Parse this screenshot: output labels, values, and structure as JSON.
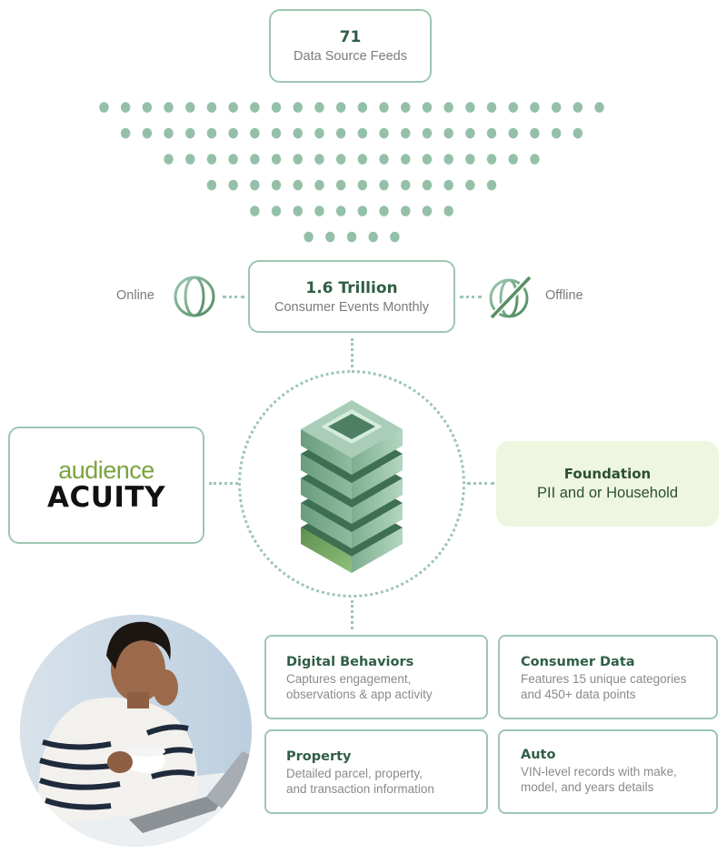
{
  "data_sources": {
    "count": "71",
    "label": "Data Source Feeds"
  },
  "funnel_dots": {
    "rows": [
      24,
      22,
      18,
      14,
      10,
      5
    ],
    "color": "#94c0a8"
  },
  "events": {
    "count": "1.6 Trillion",
    "label": "Consumer Events Monthly"
  },
  "channels": {
    "online": {
      "label": "Online",
      "icon": "globe-icon"
    },
    "offline": {
      "label": "Offline",
      "icon": "globe-crossed-icon"
    }
  },
  "hub": {
    "icon": "server-stack-icon"
  },
  "logo": {
    "top": "audience",
    "bottom": "ACUITY"
  },
  "foundation": {
    "title": "Foundation",
    "description": "PII and or Household"
  },
  "cards": [
    {
      "title": "Digital Behaviors",
      "line1": "Captures engagement,",
      "line2": "observations & app activity"
    },
    {
      "title": "Consumer Data",
      "line1": "Features 15 unique categories",
      "line2": "and 450+ data points"
    },
    {
      "title": "Property",
      "line1": "Detailed parcel, property,",
      "line2": "and transaction information"
    },
    {
      "title": "Auto",
      "line1": "VIN-level records with make,",
      "line2": "model, and years details"
    }
  ],
  "photo": {
    "description": "woman-with-coffee-at-laptop"
  },
  "colors": {
    "accent": "#9cc7b1",
    "heading": "#2f5e45",
    "muted_text": "#7b7b7b",
    "foundation_bg": "#eef6df",
    "logo_green": "#7ba33f"
  }
}
